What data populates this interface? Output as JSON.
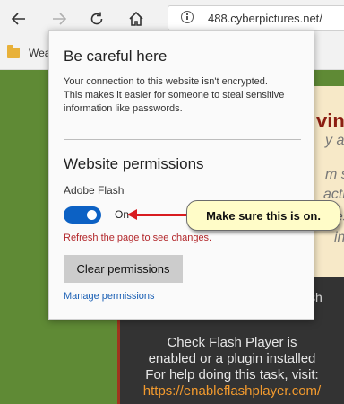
{
  "browser": {
    "url": "488.cyberpictures.net/",
    "favorites_item": "Wea"
  },
  "page_behind": {
    "heading_fragment": "vin",
    "lines": [
      "y and",
      "m se",
      "actio",
      "ges",
      "in"
    ],
    "flash_word": "sh",
    "message_lines": [
      "Check Flash Player is",
      "enabled or a plugin installed",
      "For help doing this task, visit:"
    ],
    "message_link": "https://enableflashplayer.com/"
  },
  "popup": {
    "title": "Be careful here",
    "description_lines": [
      "Your connection to this website isn't encrypted.",
      "This makes it easier for someone to steal sensitive",
      "information like passwords."
    ],
    "permissions_title": "Website permissions",
    "flash_label": "Adobe Flash",
    "toggle_label": "On",
    "refresh_text": "Refresh the page to see changes.",
    "clear_button": "Clear permissions",
    "manage_link": "Manage permissions"
  },
  "callout": {
    "text": "Make sure this is on."
  },
  "colors": {
    "page_green": "#5f8a35",
    "toggle_blue": "#0c61c4",
    "refresh_red": "#b2272b",
    "link_blue": "#1a5fb4",
    "arrow_red": "#d81c20",
    "callout_bg": "#fffcc8"
  }
}
